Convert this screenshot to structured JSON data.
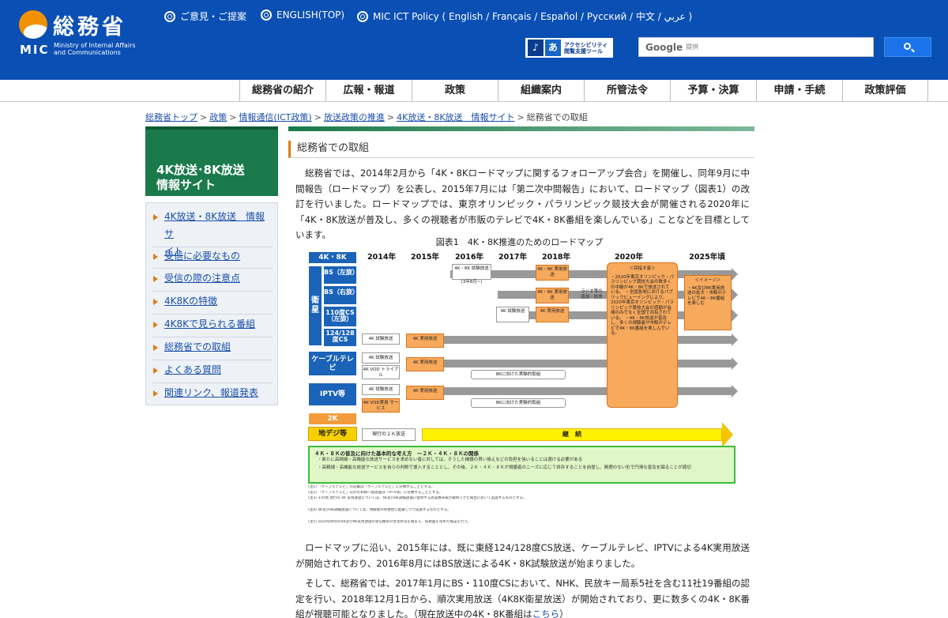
{
  "header": {
    "logo_kanji": "総務省",
    "logo_mic": "MIC",
    "logo_ministry": [
      "Ministry of Internal Affairs",
      "and Communications"
    ],
    "toplinks": [
      {
        "label": "ご意見・ご提案"
      },
      {
        "label": "ENGLISH(TOP)"
      },
      {
        "label": "MIC ICT Policy ( English / Français / Español / Pусский / 中文 / عربي )"
      }
    ],
    "accessibility": {
      "line1": "アクセシビリティ",
      "line2": "閲覧支援ツール",
      "a_glyph": "あ"
    },
    "search": {
      "brand": "Google",
      "provided": "提供"
    }
  },
  "gnav": {
    "items": [
      {
        "label": "総務省の紹介"
      },
      {
        "label": "広報・報道"
      },
      {
        "label": "政策"
      },
      {
        "label": "組織案内"
      },
      {
        "label": "所管法令"
      },
      {
        "label": "予算・決算"
      },
      {
        "label": "申請・手続"
      },
      {
        "label": "政策評価"
      }
    ]
  },
  "breadcrumb": {
    "items": [
      "総務省トップ",
      "政策",
      "情報通信(ICT政策)",
      "放送政策の推進",
      "4K放送・8K放送　情報サイト"
    ],
    "separator": ">",
    "current": "総務省での取組"
  },
  "sidebar": {
    "title_line1": "4K放送･8K放送",
    "title_line2": "情報サイト",
    "items": [
      {
        "label_line1": "4K放送・8K放送　情報サ",
        "label_line2": "イト"
      },
      {
        "label_line1": "受信に必要なもの"
      },
      {
        "label_line1": "受信の際の注意点"
      },
      {
        "label_line1": "4K8Kの特徴"
      },
      {
        "label_line1": "4K8Kで見られる番組"
      },
      {
        "label_line1": "総務省での取組"
      },
      {
        "label_line1": "よくある質問"
      },
      {
        "label_line1": "関連リンク、報道発表"
      }
    ]
  },
  "main": {
    "title": "総務省での取組",
    "para1": "総務省では、2014年2月から「4K・8Kロードマップに関するフォローアップ会合」を開催し、同年9月に中間報告（ロードマップ）を公表し、2015年7月には「第二次中間報告」において、ロードマップ（図表1）の改訂を行いました。ロードマップでは、東京オリンピック・パラリンピック競技大会が開催される2020年に「4K・8K放送が普及し、多くの視聴者が市販のテレビで4K・8K番組を楽しんでいる」ことなどを目標としています。",
    "figure": {
      "caption": "図表1　4K・8K推進のためのロードマップ",
      "corner_label": "4K・8K",
      "years": [
        "2014年",
        "2015年",
        "2016年",
        "2017年",
        "2018年",
        "2020年",
        "2025年頃"
      ],
      "lanes": {
        "satellite": "衛星",
        "bs_left": "BS（左旋）",
        "bs_right": "BS（右旋）",
        "cs110": "110度CS（左旋）",
        "cs124": "124/128度CS",
        "cable": "ケーブルテレビ",
        "iptv": "IPTV等",
        "k2": "2K",
        "terrestrial": "地デジ等"
      },
      "boxes": {
        "trial_2016": "4K・8K 試験放送",
        "trial_2016_note": "(3年8月~)",
        "practical_4k8k": "4K・8K 実用放送",
        "practical_4k8k_2": "4K・8K 実用放送",
        "trial_4k_2017": "4K 試験放送",
        "practical_4k_2018": "4K 実用放送",
        "trial_4k": "4K 試験放送",
        "practical_4k": "4K 実用放送",
        "vod_trial": "4K VOD トライアル",
        "vod_service": "4K VOD実用 サービス",
        "k8_toward": "8Kに向けた実験的取組",
        "current_2k": "現行の２Ｋ放送",
        "continue": "継　続",
        "target_title": "＜目指す姿＞",
        "target_body": "・2020年東京オリンピック・パラリンピック競技大会の数多くの中継が4K・8Kで放送されている。 ・全国各地におけるパブリックビューイングにより、2020年東京オリンピック・パラリンピック競技大会の感動が会場のみでなく全国で共有されている。 ・4K・8K放送が普及し、多くの視聴者が市販のテレビで4K・8K番組を楽しんでいる。",
        "image_title": "＜イメージ＞",
        "image_body": "・4K及び8K実用放送の拡大・市販のテレビで4K・8K番組を楽しむ",
        "side_note": "ラジオ等の追加・拡充"
      },
      "note_title": "４Ｋ・８Ｋの普及に向けた基本的な考え方　～２Ｋ・４Ｋ・８Ｋの関係",
      "note_lines": [
        "・新たに高精細・高機能な放送サービスを求めない者に対しては、そうした機器の買い換えなどの負担を強いることは避ける必要がある",
        "・高精細・高機能な放送サービスを自らの判断で導入することとし、その後、２Ｋ・４Ｋ・８Ｋが視聴者のニーズに応じて併存することを前提し、無理のない形で円滑な普及を図ることが適切"
      ],
      "footnotes": [
        "(注1) 「ケーブルテレビ」の記載は「ケーブルテレビ」に分類することとする。",
        "(注2) 「ケーブルテレビ」以外の有線一般放送は「IPTV等」に分類することとする。",
        "(注3) その他 現行の 4K 実用放送については、4K及び8K試験放送に使用する周波数帯域が確保できた場合において実施するものとする。",
        "(注4) 4K及び8K試験放送については、視聴者の利便性に配慮しつつ実施するものとする。",
        "(注5) 2020年時点の4K及び8K実用放送の受信機等の普及状況を踏まえ、技術面を含めた検証を行う。"
      ]
    },
    "para2": "ロードマップに沿い、2015年には、既に東経124/128度CS放送、ケーブルテレビ、IPTVによる4K実用放送が開始されており、2016年8月にはBS放送による4K・8K試験放送が始まりました。",
    "para3_text": "そして、総務省では、2017年1月にBS・110度CSにおいて、NHK、民放キー局系5社を含む11社19番組の認定を行い、2018年12月1日から、順次実用放送（4K8K衛星放送）が開始されており、更に数多くの4K・8K番組が視聴可能となりました。（現在放送中の4K・8K番組は",
    "para3_link": "こちら",
    "para3_end": "）"
  }
}
